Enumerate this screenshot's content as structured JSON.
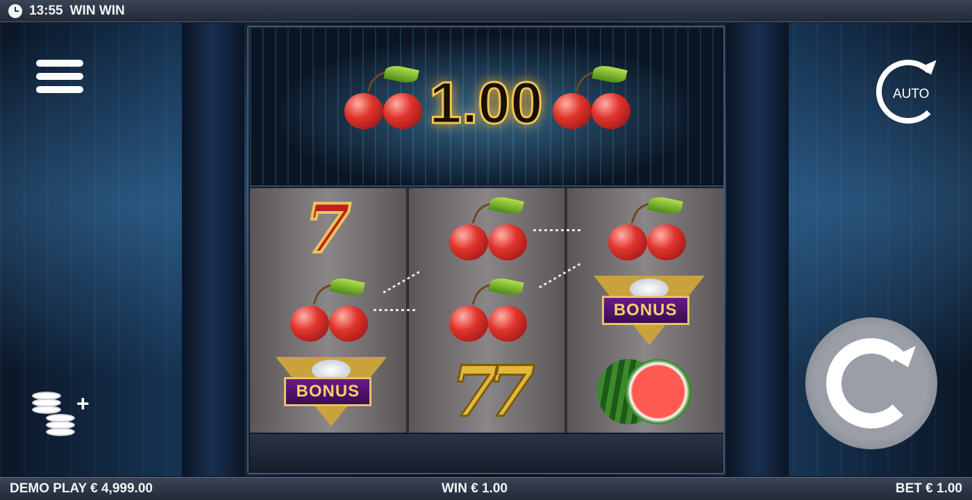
{
  "header": {
    "time": "13:55",
    "title": "WIN WIN"
  },
  "topper": {
    "win_amount": "1.00"
  },
  "reels": [
    [
      "seven",
      "cherry",
      "bonus"
    ],
    [
      "cherry",
      "cherry",
      "double-seven"
    ],
    [
      "cherry",
      "bonus",
      "watermelon"
    ]
  ],
  "symbols": {
    "bonus_label": "BONUS",
    "seven": "7",
    "double_seven": "77"
  },
  "controls": {
    "auto_label": "AUTO"
  },
  "footer": {
    "demo_label": "DEMO PLAY € 4,999.00",
    "win_label": "WIN € 1.00",
    "bet_label": "BET € 1.00"
  },
  "colors": {
    "accent_gold": "#f2c450",
    "cherry_red": "#e0342c",
    "bar_bg": "#2a3242"
  }
}
